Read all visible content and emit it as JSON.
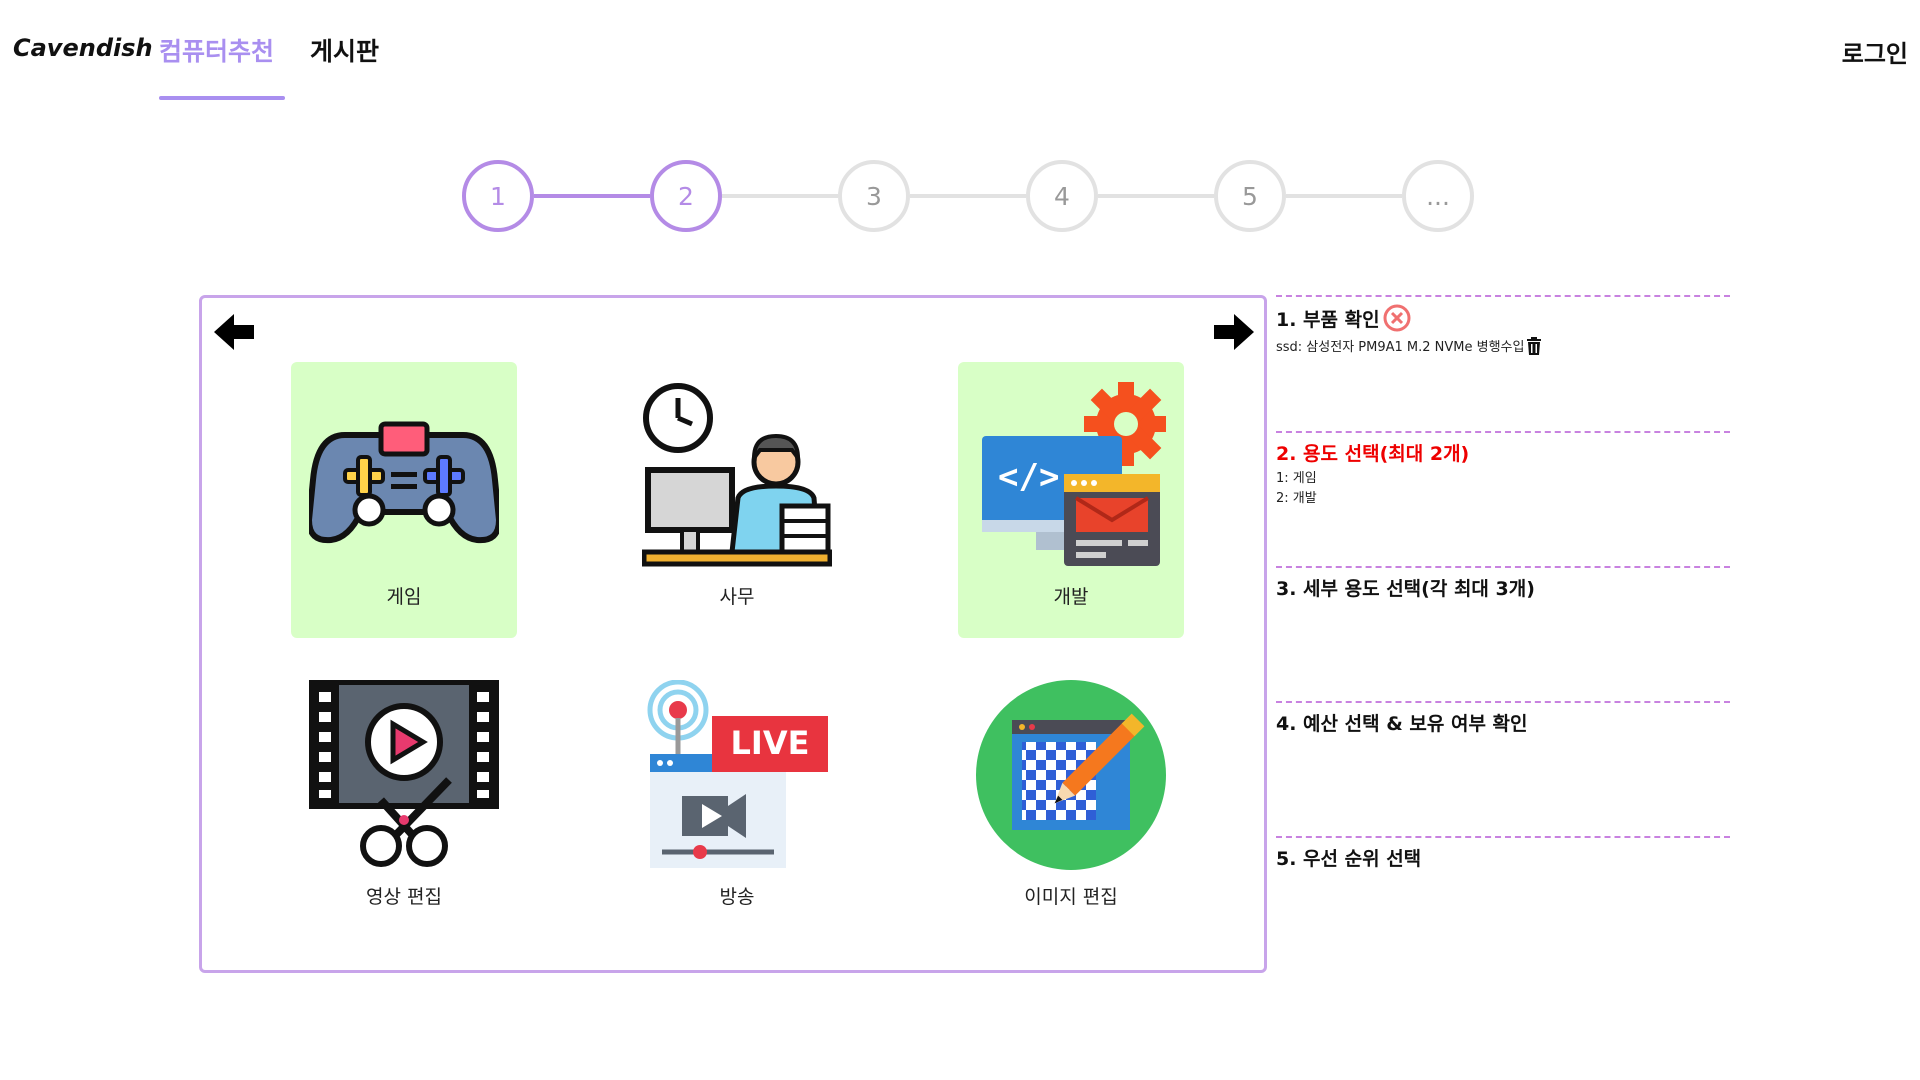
{
  "nav": {
    "brand": "Cavendish",
    "tabs": [
      {
        "label": "컴퓨터추천",
        "active": true
      },
      {
        "label": "게시판",
        "active": false
      }
    ],
    "login": "로그인"
  },
  "stepper": {
    "steps": [
      "1",
      "2",
      "3",
      "4",
      "5",
      "..."
    ],
    "current_step": 2
  },
  "panel": {
    "cards": [
      {
        "label": "게임",
        "selected": true,
        "icon": "gamepad-icon"
      },
      {
        "label": "사무",
        "selected": false,
        "icon": "office-worker-icon"
      },
      {
        "label": "개발",
        "selected": true,
        "icon": "code-monitor-icon"
      },
      {
        "label": "영상 편집",
        "selected": false,
        "icon": "film-scissors-icon"
      },
      {
        "label": "방송",
        "selected": false,
        "icon": "live-broadcast-icon"
      },
      {
        "label": "이미지 편집",
        "selected": false,
        "icon": "image-edit-icon"
      }
    ]
  },
  "summary": {
    "sections": [
      {
        "title": "1. 부품 확인",
        "items": [
          "ssd: 삼성전자 PM9A1 M.2 NVMe 병행수입"
        ]
      },
      {
        "title": "2. 용도 선택(최대 2개)",
        "items": [
          "1: 게임",
          "2: 개발"
        ]
      },
      {
        "title": "3. 세부 용도 선택(각 최대 3개)",
        "items": []
      },
      {
        "title": "4. 예산 선택 & 보유 여부 확인",
        "items": []
      },
      {
        "title": "5. 우선 순위 선택",
        "items": []
      }
    ]
  },
  "colors": {
    "accent": "#a98ff0",
    "step_active": "#b48be6",
    "panel_border": "#c8a4ea",
    "selected_card": "#d8ffc6",
    "alert_text": "#ee0000",
    "divider": "#c882e0"
  }
}
